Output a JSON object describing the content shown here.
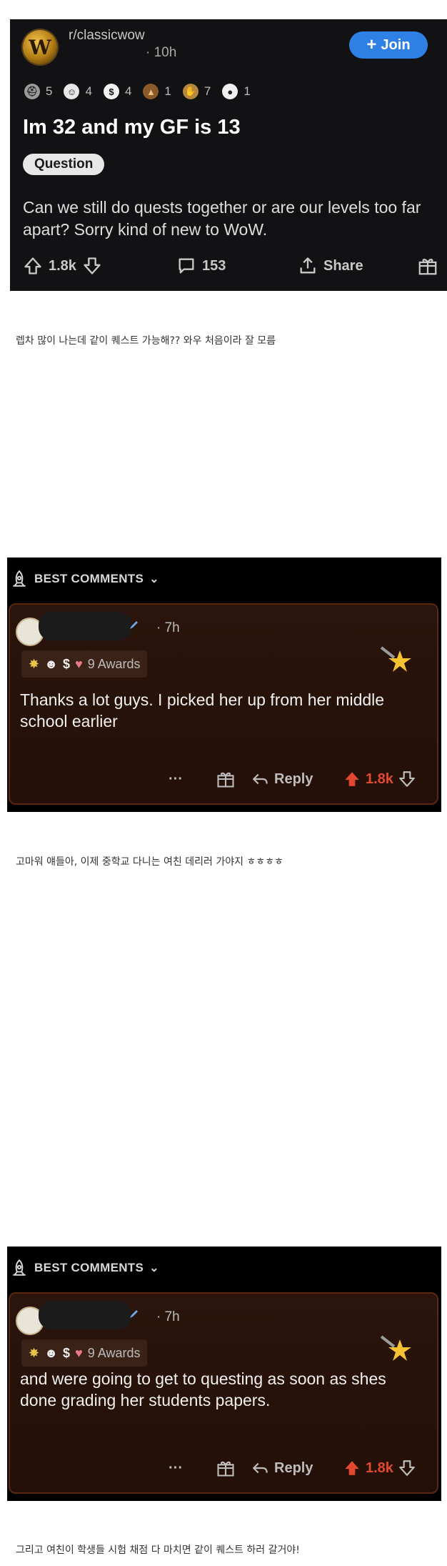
{
  "post": {
    "subreddit": "r/classicwow",
    "time": "· 10h",
    "join_label": "Join",
    "awards": [
      {
        "icon": "helmet-award-icon",
        "count": "5",
        "bg": "#9a9a9a"
      },
      {
        "icon": "face-award-icon",
        "count": "4",
        "bg": "#e8e8e8"
      },
      {
        "icon": "dollar-award-icon",
        "count": "4",
        "bg": "#f2f2f2"
      },
      {
        "icon": "poop-award-icon",
        "count": "1",
        "bg": "#8a5a2a"
      },
      {
        "icon": "hand-award-icon",
        "count": "7",
        "bg": "#b5873f"
      },
      {
        "icon": "snoo-award-icon",
        "count": "1",
        "bg": "#f0f0f0"
      }
    ],
    "title": "Im 32 and my GF is 13",
    "flair": "Question",
    "body": "Can we still do quests together or are our levels too far apart? Sorry kind of new to WoW.",
    "upvotes": "1.8k",
    "comments": "153",
    "share": "Share"
  },
  "caption1": "렙차 많이 나는데 같이 퀘스트 가능해?? 와우 처음이라 잘 모름",
  "comment1": {
    "header": "BEST COMMENTS",
    "time": "· 7h",
    "awards_label": "9 Awards",
    "text": "Thanks a lot guys. I picked her up from her middle school earlier",
    "reply": "Reply",
    "votes": "1.8k"
  },
  "caption2": "고마워 얘들아, 이제 중학교 다니는 여친 데리러 가야지 ㅎㅎㅎㅎ",
  "comment2": {
    "header": "BEST COMMENTS",
    "time": "· 7h",
    "awards_label": "9 Awards",
    "text": "and were going to get to questing as soon as shes done grading her students papers.",
    "reply": "Reply",
    "votes": "1.8k"
  },
  "caption3": "그리고 여친이 학생들 시험 채점 다 마치면 같이 퀘스트 하러 갈거야!",
  "colors": {
    "join": "#2f80e4",
    "upvote": "#e2492f",
    "card_border": "#5b2712"
  }
}
